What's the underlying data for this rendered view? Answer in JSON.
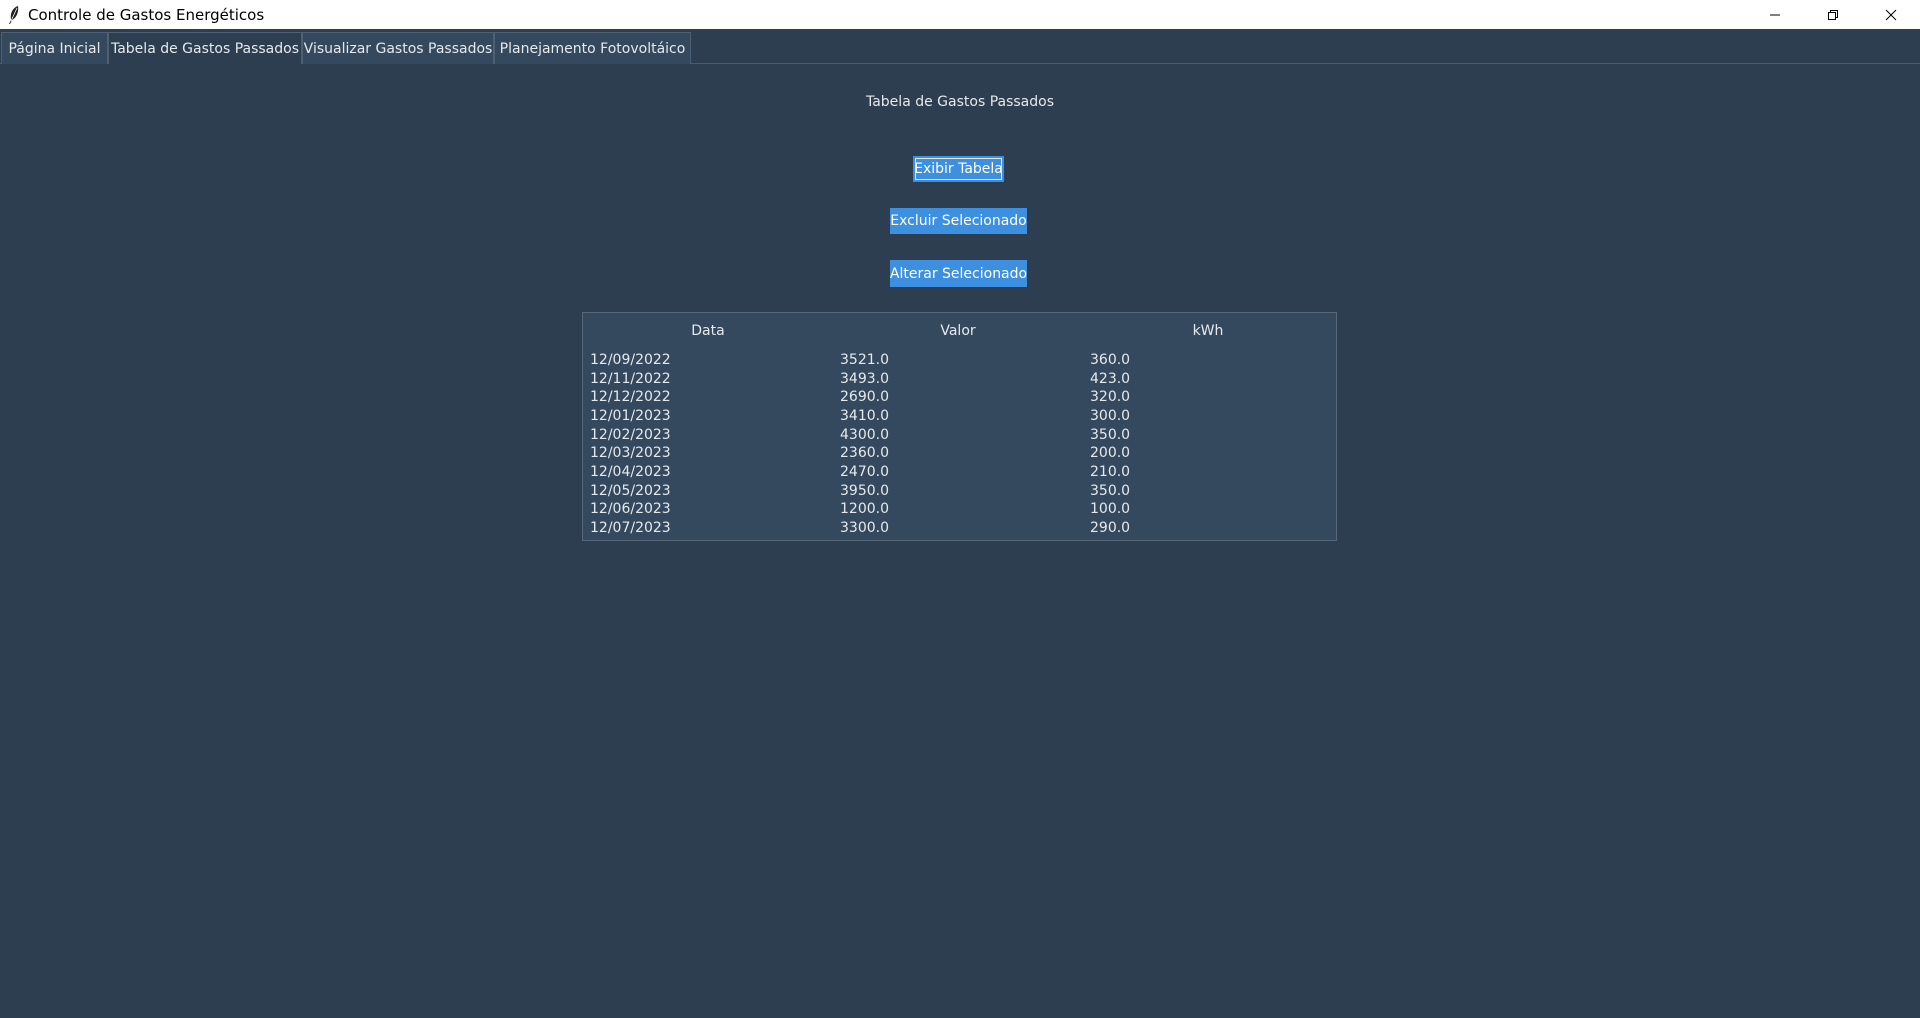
{
  "window": {
    "title": "Controle de Gastos Energéticos",
    "app_icon": "feather-icon",
    "controls": [
      "minimize-icon",
      "restore-icon",
      "close-icon"
    ]
  },
  "tabs": [
    {
      "label": "Página Inicial",
      "active": false
    },
    {
      "label": "Tabela de Gastos Passados",
      "active": true
    },
    {
      "label": "Visualizar Gastos Passados",
      "active": false
    },
    {
      "label": "Planejamento Fotovoltáico",
      "active": false
    }
  ],
  "main": {
    "title": "Tabela de Gastos Passados",
    "buttons": {
      "show": "Exibir Tabela",
      "delete": "Excluir Selecionado",
      "edit": "Alterar Selecionado"
    }
  },
  "table": {
    "columns": [
      "Data",
      "Valor",
      "kWh"
    ],
    "rows": [
      [
        "12/09/2022",
        "3521.0",
        "360.0"
      ],
      [
        "12/11/2022",
        "3493.0",
        "423.0"
      ],
      [
        "12/12/2022",
        "2690.0",
        "320.0"
      ],
      [
        "12/01/2023",
        "3410.0",
        "300.0"
      ],
      [
        "12/02/2023",
        "4300.0",
        "350.0"
      ],
      [
        "12/03/2023",
        "2360.0",
        "200.0"
      ],
      [
        "12/04/2023",
        "2470.0",
        "210.0"
      ],
      [
        "12/05/2023",
        "3950.0",
        "350.0"
      ],
      [
        "12/06/2023",
        "1200.0",
        "100.0"
      ],
      [
        "12/07/2023",
        "3300.0",
        "290.0"
      ]
    ]
  },
  "colors": {
    "background": "#2c3e50",
    "table_background": "#34495e",
    "button": "#3d8fe0",
    "text": "#e6e9ec"
  }
}
